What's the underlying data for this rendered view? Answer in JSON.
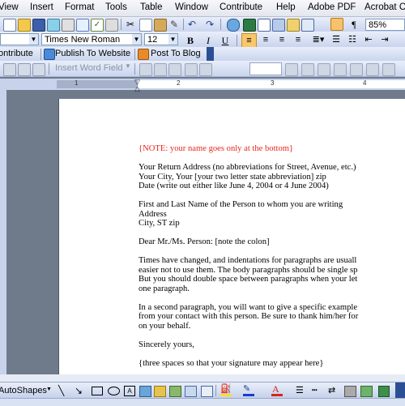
{
  "menu": {
    "items": [
      "View",
      "Insert",
      "Format",
      "Tools",
      "Table",
      "Window",
      "Contribute",
      "Help",
      "Adobe PDF",
      "Acrobat C"
    ]
  },
  "standard_toolbar": {
    "zoom": "85%"
  },
  "formatting_toolbar": {
    "style": "",
    "font": "Times New Roman",
    "size": "12",
    "bold": "B",
    "italic": "I",
    "underline": "U",
    "paragraph_mark": "¶"
  },
  "contribute_toolbar": {
    "contribute_label": "ontribute",
    "publish_label": "Publish To Website",
    "post_label": "Post To Blog"
  },
  "mail_merge_toolbar": {
    "insert_word_field": "Insert Word Field"
  },
  "ruler": {
    "numbers": [
      "1",
      "2",
      "3",
      "4"
    ]
  },
  "document": {
    "lines": [
      {
        "text": "{NOTE: your name goes only at the bottom}",
        "style": "red"
      },
      {
        "text": "",
        "style": "gap"
      },
      {
        "text": "Your Return Address (no abbreviations for Street, Avenue, etc.)",
        "style": "normal"
      },
      {
        "text": "Your City, Your [your two letter state abbreviation] zip",
        "style": "normal"
      },
      {
        "text": "Date (write out either like June 4, 2004 or 4 June 2004)",
        "style": "normal"
      },
      {
        "text": "",
        "style": "gap"
      },
      {
        "text": "First and Last Name of the Person to whom you are writing",
        "style": "normal"
      },
      {
        "text": "Address",
        "style": "normal"
      },
      {
        "text": "City, ST zip",
        "style": "normal"
      },
      {
        "text": "",
        "style": "gap"
      },
      {
        "text": "Dear Mr./Ms. Person: [note the colon]",
        "style": "normal"
      },
      {
        "text": "",
        "style": "gap"
      },
      {
        "text": "Times have changed, and indentations for paragraphs are usuall",
        "style": "normal"
      },
      {
        "text": "easier not to use them. The body paragraphs should be single sp",
        "style": "normal"
      },
      {
        "text": "But you should double space between paragraphs when your let",
        "style": "normal"
      },
      {
        "text": "one paragraph.",
        "style": "normal"
      },
      {
        "text": "",
        "style": "gap"
      },
      {
        "text": "In a second paragraph, you will want to give a specific example",
        "style": "normal"
      },
      {
        "text": "from your contact with this person. Be sure to thank him/her for",
        "style": "normal"
      },
      {
        "text": "on your behalf.",
        "style": "normal"
      },
      {
        "text": "",
        "style": "gap"
      },
      {
        "text": "Sincerely yours,",
        "style": "normal"
      },
      {
        "text": "",
        "style": "gap"
      },
      {
        "text": "{three spaces so that your signature may appear here}",
        "style": "normal"
      }
    ]
  },
  "drawing_toolbar": {
    "autoshapes": "AutoShapes"
  },
  "colors": {
    "note_red": "#e8261c",
    "toolbar_blue": "#c9d5ee",
    "workspace": "#6f7b8b"
  }
}
